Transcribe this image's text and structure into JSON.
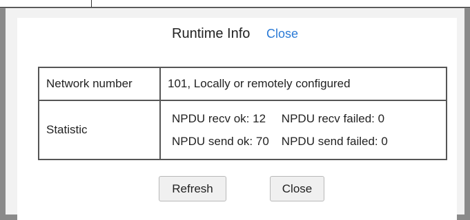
{
  "dialog": {
    "title": "Runtime Info",
    "title_close_link": "Close"
  },
  "info_table": {
    "network": {
      "label": "Network number",
      "value": "101, Locally or remotely configured"
    },
    "statistic": {
      "label": "Statistic",
      "npdu_recv_ok": "NPDU recv ok: 12",
      "npdu_recv_failed": "NPDU recv failed: 0",
      "npdu_send_ok": "NPDU send ok: 70",
      "npdu_send_failed": "NPDU send failed: 0"
    }
  },
  "buttons": {
    "refresh_label": "Refresh",
    "close_label": "Close"
  }
}
